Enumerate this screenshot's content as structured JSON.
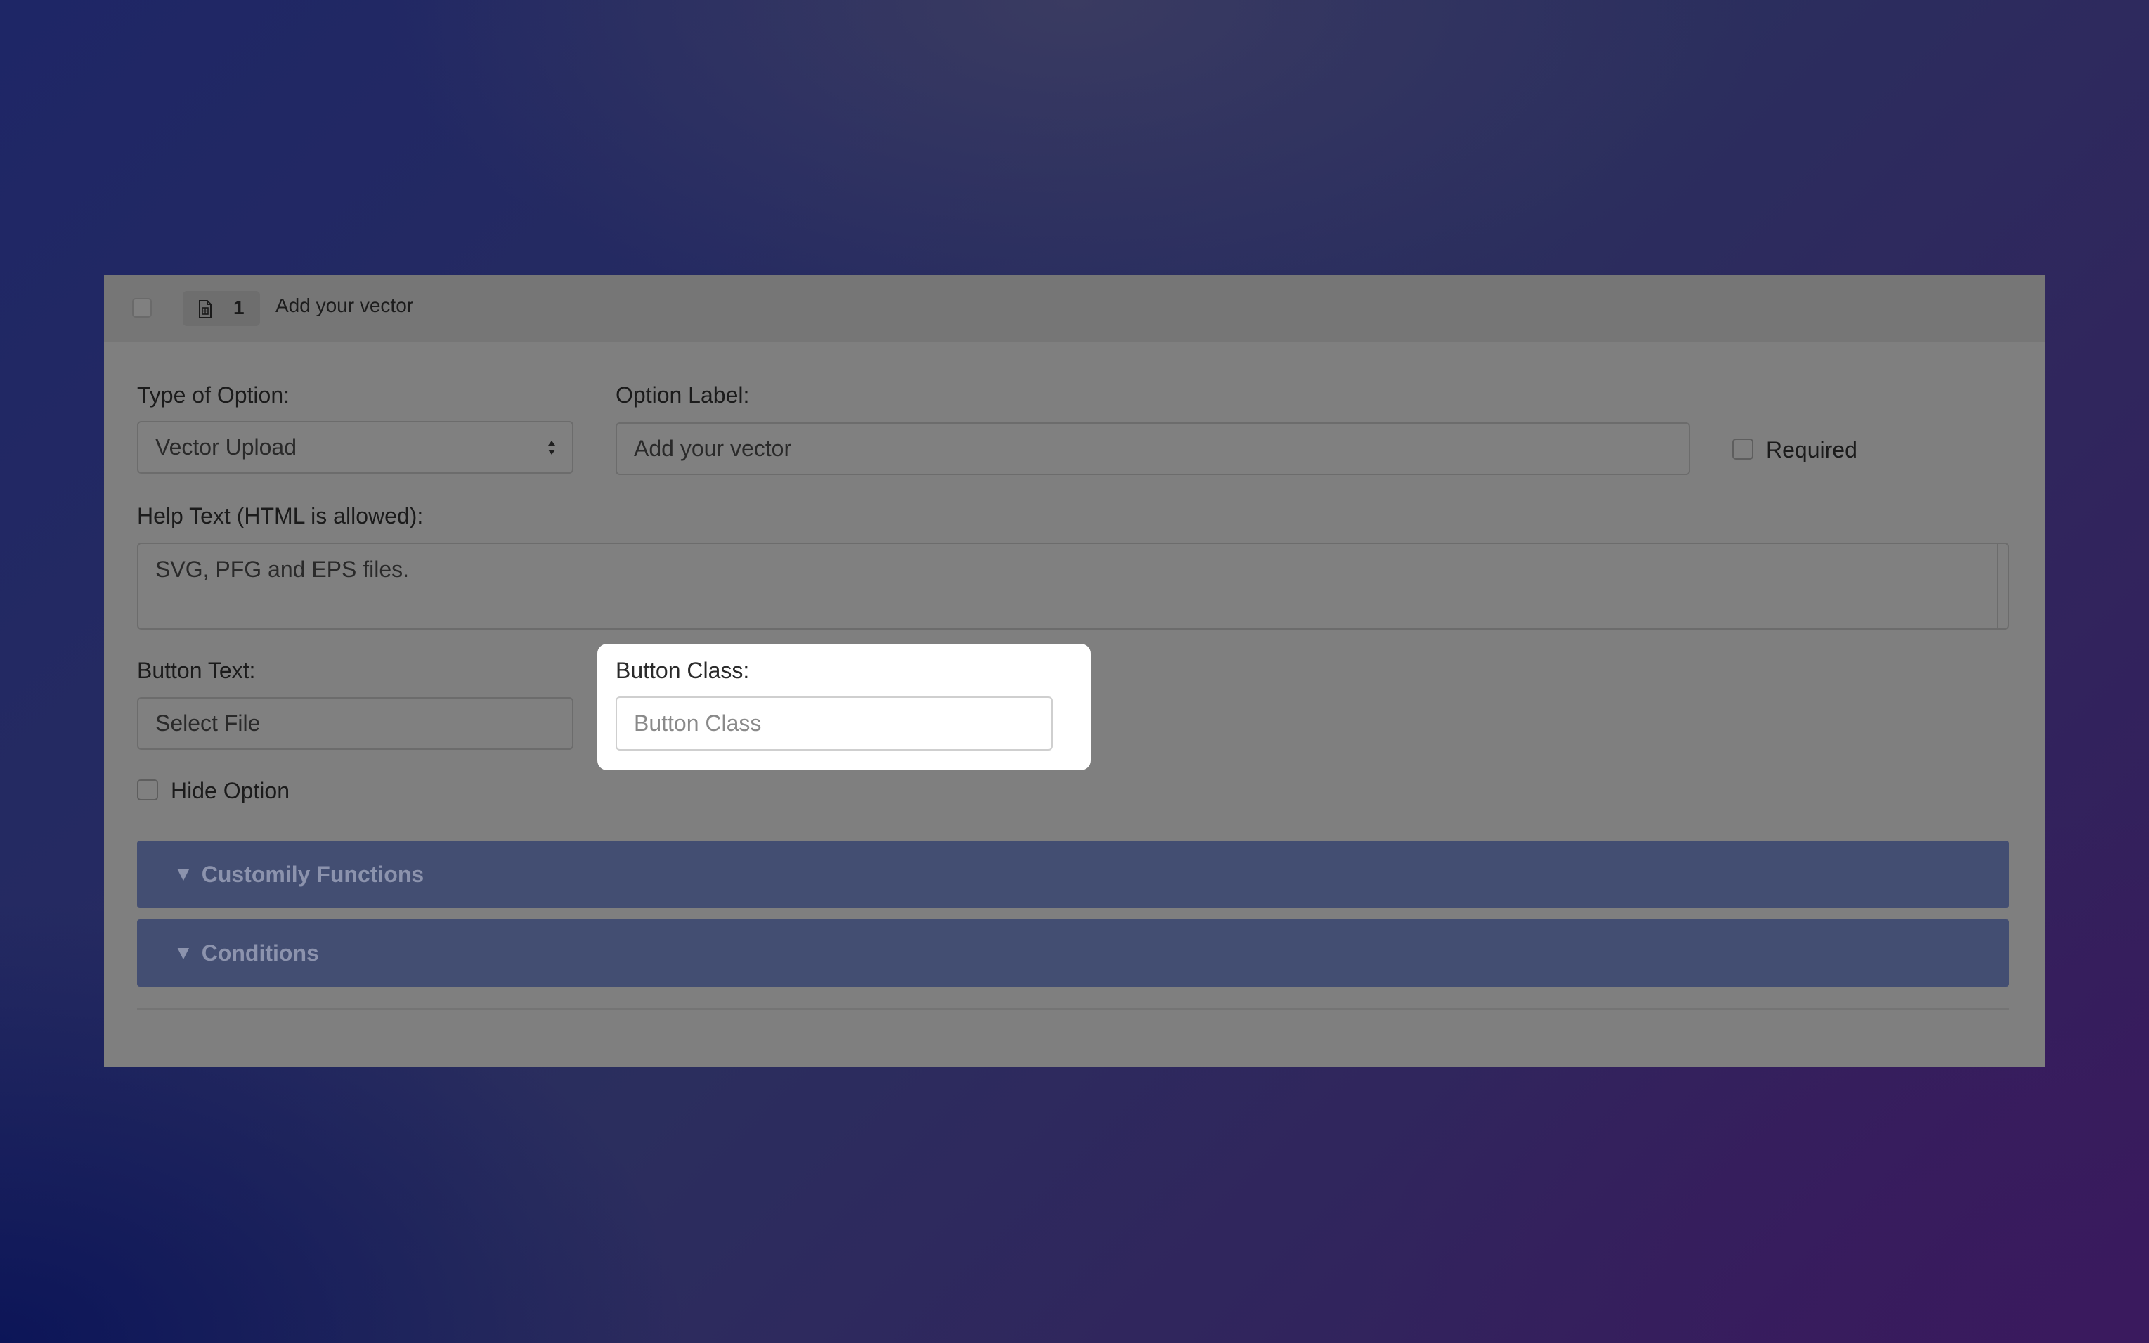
{
  "header": {
    "number": "1",
    "title": "Add your vector"
  },
  "type_of_option": {
    "label": "Type of Option:",
    "value": "Vector Upload"
  },
  "option_label": {
    "label": "Option Label:",
    "value": "Add your vector"
  },
  "required": {
    "label": "Required"
  },
  "help_text": {
    "label": "Help Text (HTML is allowed):",
    "value": "SVG, PFG and EPS files."
  },
  "button_text": {
    "label": "Button Text:",
    "value": "Select File"
  },
  "button_class": {
    "label": "Button Class:",
    "placeholder": "Button Class"
  },
  "hide_option": {
    "label": "Hide Option"
  },
  "accordions": [
    {
      "label": "Customily Functions"
    },
    {
      "label": "Conditions"
    }
  ],
  "icons": {
    "badge_icon": "file-icon",
    "accordion_icon": "triangle-down-icon"
  },
  "colors": {
    "overlay_panel": "#7f7f7f",
    "accordion_bg": "#434e72",
    "highlight_bg": "#ffffff"
  }
}
